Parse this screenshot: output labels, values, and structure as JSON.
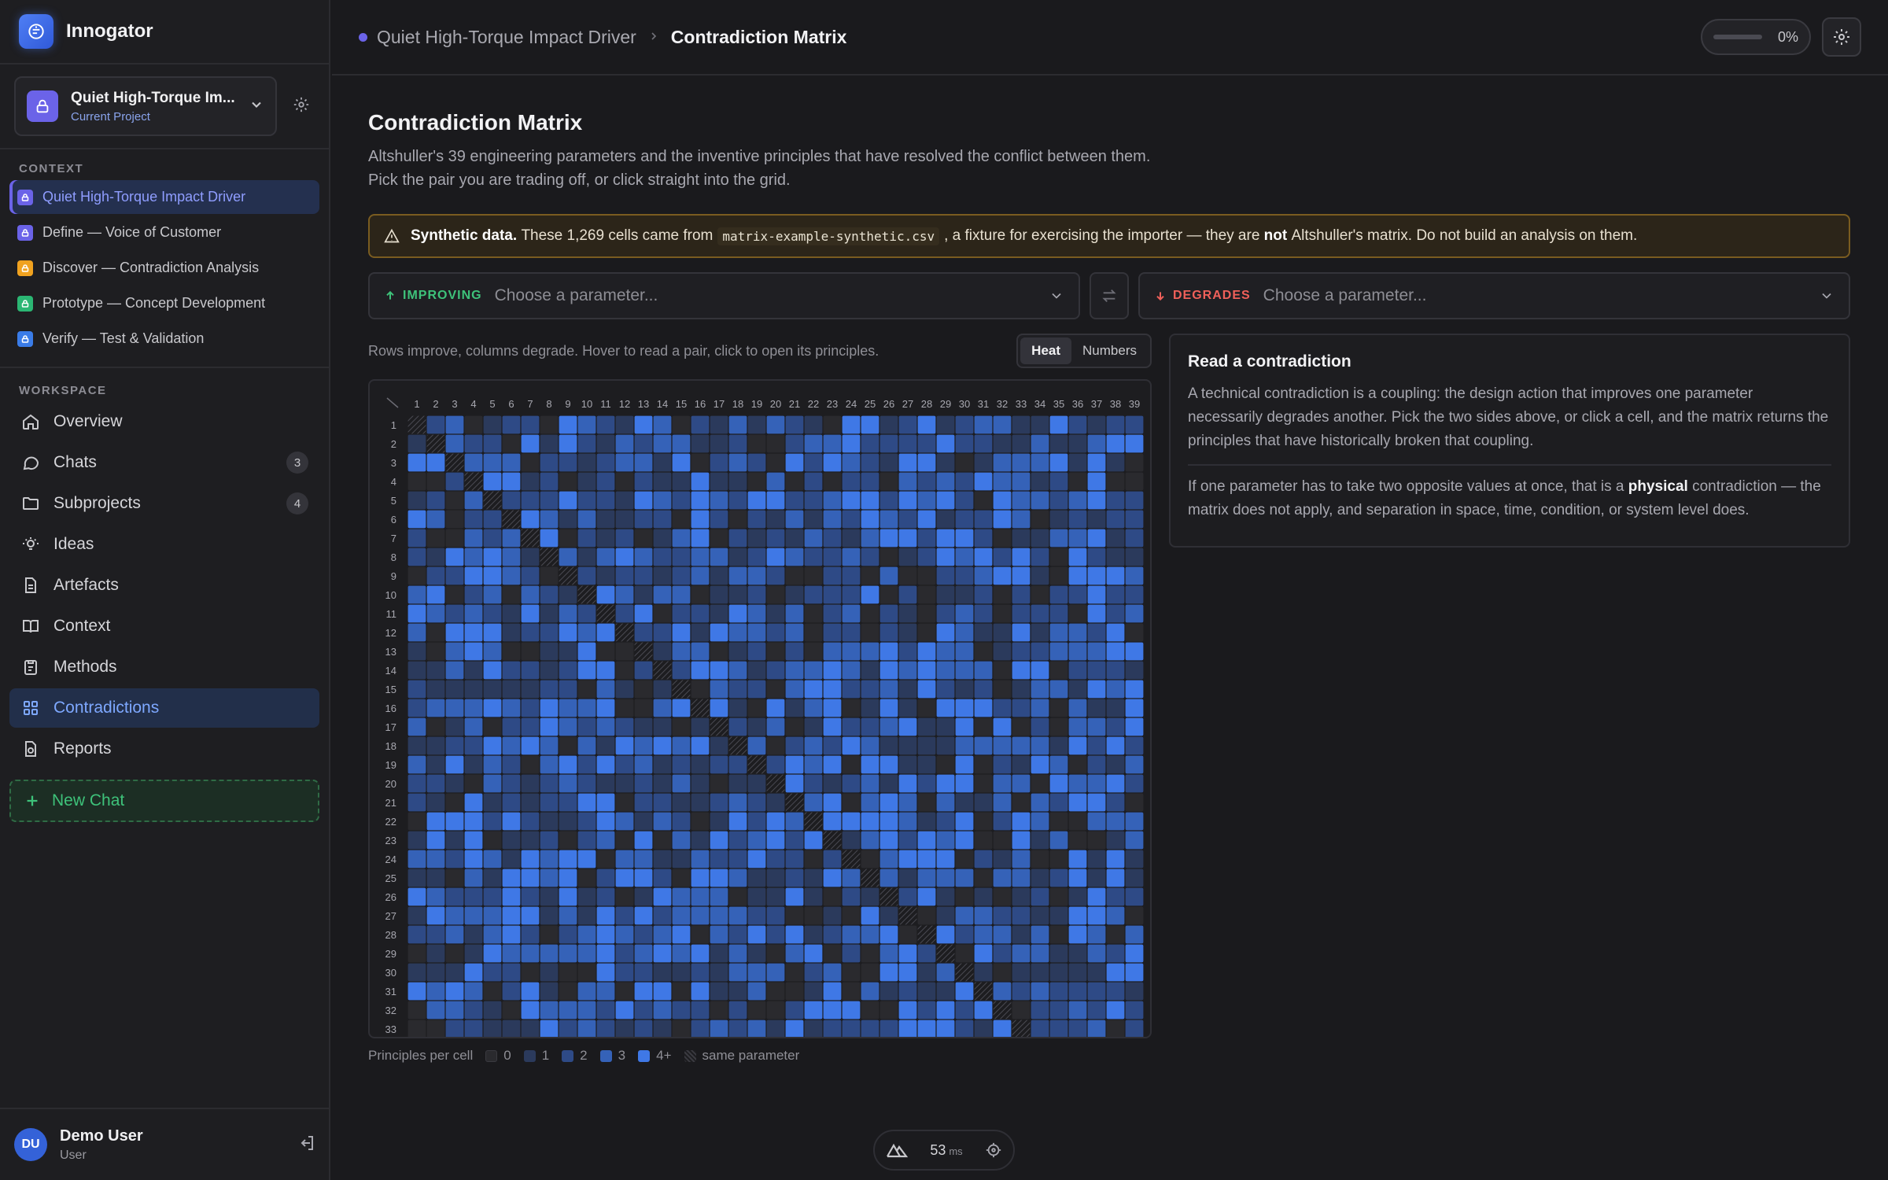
{
  "app": {
    "name": "Innogator"
  },
  "project": {
    "name": "Quiet High-Torque Im...",
    "subtitle": "Current Project"
  },
  "context": {
    "label": "CONTEXT",
    "items": [
      {
        "label": "Quiet High-Torque Impact Driver",
        "color": "#6b63e8",
        "active": true
      },
      {
        "label": "Define — Voice of Customer",
        "color": "#6b63e8"
      },
      {
        "label": "Discover — Contradiction Analysis",
        "color": "#f0a21f"
      },
      {
        "label": "Prototype — Concept Development",
        "color": "#2bb673"
      },
      {
        "label": "Verify — Test & Validation",
        "color": "#3a7ce8"
      }
    ]
  },
  "workspace": {
    "label": "WORKSPACE",
    "items": [
      {
        "label": "Overview",
        "icon": "home-icon"
      },
      {
        "label": "Chats",
        "icon": "chat-icon",
        "badge": "3"
      },
      {
        "label": "Subprojects",
        "icon": "folder-icon",
        "badge": "4"
      },
      {
        "label": "Ideas",
        "icon": "lightbulb-icon"
      },
      {
        "label": "Artefacts",
        "icon": "file-icon"
      },
      {
        "label": "Context",
        "icon": "book-icon"
      },
      {
        "label": "Methods",
        "icon": "clipboard-icon"
      },
      {
        "label": "Contradictions",
        "icon": "grid-icon",
        "active": true
      },
      {
        "label": "Reports",
        "icon": "report-icon"
      }
    ],
    "new_chat": "New Chat"
  },
  "user": {
    "initials": "DU",
    "name": "Demo User",
    "role": "User"
  },
  "breadcrumb": {
    "project": "Quiet High-Torque Impact Driver",
    "page": "Contradiction Matrix"
  },
  "progress": {
    "value": 0,
    "label": "0%"
  },
  "page": {
    "title": "Contradiction Matrix",
    "description": "Altshuller's 39 engineering parameters and the inventive principles that have resolved the conflict between them. Pick the pair you are trading off, or click straight into the grid."
  },
  "warning": {
    "bold": "Synthetic data.",
    "text1": "These 1,269 cells came from",
    "file": "matrix-example-synthetic.csv",
    "text2": ", a fixture for exercising the importer — they are",
    "bold2": "not",
    "text3": "Altshuller's matrix. Do not build an analysis on them."
  },
  "pickers": {
    "improving_label": "IMPROVING",
    "improving_placeholder": "Choose a parameter...",
    "degrades_label": "DEGRADES",
    "degrades_placeholder": "Choose a parameter..."
  },
  "matrix": {
    "hint": "Rows improve, columns degrade. Hover to read a pair, click to open its principles.",
    "modes": [
      "Heat",
      "Numbers"
    ],
    "active_mode": "Heat",
    "columns": 39,
    "visible_rows": 33,
    "colors": [
      "#2a2a2e",
      "#2b3a5c",
      "#2e4a86",
      "#3562b8",
      "#3f78e6"
    ]
  },
  "legend": {
    "label": "Principles per cell",
    "items": [
      {
        "label": "0",
        "color": "#2a2a2e"
      },
      {
        "label": "1",
        "color": "#2b3a5c"
      },
      {
        "label": "2",
        "color": "#2e4a86"
      },
      {
        "label": "3",
        "color": "#3562b8"
      },
      {
        "label": "4+",
        "color": "#3f78e6"
      }
    ],
    "same": "same parameter"
  },
  "info": {
    "title": "Read a contradiction",
    "p1": "A technical contradiction is a coupling: the design action that improves one parameter necessarily degrades another. Pick the two sides above, or click a cell, and the matrix returns the principles that have historically broken that coupling.",
    "p2_a": "If one parameter has to take two opposite values at once, that is a",
    "p2_bold": "physical",
    "p2_b": "contradiction — the matrix does not apply, and separation in space, time, condition, or system level does."
  },
  "devtools": {
    "ms": "53",
    "unit": "ms"
  }
}
